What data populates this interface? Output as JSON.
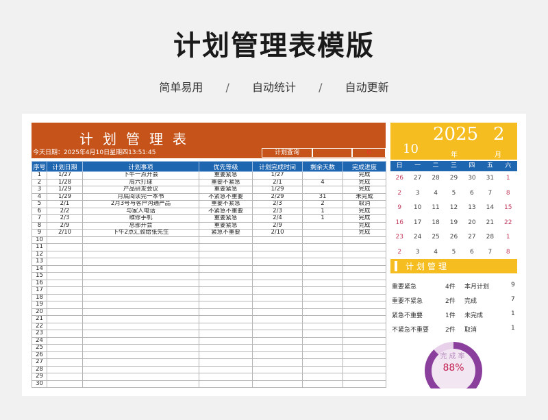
{
  "hero": {
    "title": "计划管理表模版",
    "sub1": "简单易用",
    "sep": "/",
    "sub2": "自动统计",
    "sub3": "自动更新"
  },
  "sheet": {
    "banner_title": "计划管理表",
    "today": "今天日期：2025年4月10日星期四13:51:45",
    "query_label": "计划查询",
    "query_value": "",
    "query_result": "0",
    "columns": [
      "序号",
      "计划日期",
      "计划事项",
      "优先等级",
      "计划完成时间",
      "剩余天数",
      "完成进度"
    ],
    "rows": [
      [
        "1",
        "1/27",
        "下午一点开会",
        "重要紧急",
        "1/27",
        "",
        "完成"
      ],
      [
        "2",
        "1/28",
        "周六打球",
        "重要不紧急",
        "2/1",
        "4",
        "完成"
      ],
      [
        "3",
        "1/29",
        "产品研发会议",
        "重要紧急",
        "1/29",
        "",
        "完成"
      ],
      [
        "4",
        "1/29",
        "月底阅读完一本书",
        "不紧急不重要",
        "2/29",
        "31",
        "未完成"
      ],
      [
        "5",
        "2/1",
        "2月3号与客户沟通产品",
        "重要不紧急",
        "2/3",
        "2",
        "取消"
      ],
      [
        "6",
        "2/2",
        "与家人电话",
        "不紧急不重要",
        "2/3",
        "1",
        "完成"
      ],
      [
        "7",
        "2/3",
        "维修手机",
        "重要紧急",
        "2/4",
        "1",
        "完成"
      ],
      [
        "8",
        "2/9",
        "总部开会",
        "重要紧急",
        "2/9",
        "",
        "完成"
      ],
      [
        "9",
        "2/10",
        "下午2点汇款给张先生",
        "紧急不重要",
        "2/10",
        "",
        "完成"
      ],
      [
        "10",
        "",
        "",
        "",
        "",
        "",
        ""
      ],
      [
        "11",
        "",
        "",
        "",
        "",
        "",
        ""
      ],
      [
        "12",
        "",
        "",
        "",
        "",
        "",
        ""
      ],
      [
        "13",
        "",
        "",
        "",
        "",
        "",
        ""
      ],
      [
        "14",
        "",
        "",
        "",
        "",
        "",
        ""
      ],
      [
        "15",
        "",
        "",
        "",
        "",
        "",
        ""
      ],
      [
        "16",
        "",
        "",
        "",
        "",
        "",
        ""
      ],
      [
        "17",
        "",
        "",
        "",
        "",
        "",
        ""
      ],
      [
        "18",
        "",
        "",
        "",
        "",
        "",
        ""
      ],
      [
        "19",
        "",
        "",
        "",
        "",
        "",
        ""
      ],
      [
        "20",
        "",
        "",
        "",
        "",
        "",
        ""
      ],
      [
        "21",
        "",
        "",
        "",
        "",
        "",
        ""
      ],
      [
        "22",
        "",
        "",
        "",
        "",
        "",
        ""
      ],
      [
        "23",
        "",
        "",
        "",
        "",
        "",
        ""
      ],
      [
        "24",
        "",
        "",
        "",
        "",
        "",
        ""
      ],
      [
        "25",
        "",
        "",
        "",
        "",
        "",
        ""
      ],
      [
        "26",
        "",
        "",
        "",
        "",
        "",
        ""
      ],
      [
        "27",
        "",
        "",
        "",
        "",
        "",
        ""
      ],
      [
        "28",
        "",
        "",
        "",
        "",
        "",
        ""
      ],
      [
        "29",
        "",
        "",
        "",
        "",
        "",
        ""
      ],
      [
        "30",
        "",
        "",
        "",
        "",
        "",
        ""
      ]
    ]
  },
  "calendar": {
    "year": "2025",
    "month": "2",
    "day": "10",
    "year_unit": "年",
    "month_unit": "月",
    "weekdays": [
      "日",
      "一",
      "二",
      "三",
      "四",
      "五",
      "六"
    ],
    "days": [
      [
        "26",
        "27",
        "28",
        "29",
        "30",
        "31",
        "1"
      ],
      [
        "2",
        "3",
        "4",
        "5",
        "6",
        "7",
        "8"
      ],
      [
        "9",
        "10",
        "11",
        "12",
        "13",
        "14",
        "15"
      ],
      [
        "16",
        "17",
        "18",
        "19",
        "20",
        "21",
        "22"
      ],
      [
        "23",
        "24",
        "25",
        "26",
        "27",
        "28",
        "1"
      ],
      [
        "2",
        "3",
        "4",
        "5",
        "6",
        "7",
        "8"
      ]
    ],
    "weekend_color": "#c23a5c"
  },
  "plan_mgmt": {
    "title": "计划管理",
    "left": [
      {
        "label": "重要紧急",
        "value": "4件"
      },
      {
        "label": "重要不紧急",
        "value": "2件"
      },
      {
        "label": "紧急不重要",
        "value": "1件"
      },
      {
        "label": "不紧急不重要",
        "value": "2件"
      }
    ],
    "right": [
      {
        "label": "本月计划",
        "value": "9"
      },
      {
        "label": "完成",
        "value": "7"
      },
      {
        "label": "未完成",
        "value": "1"
      },
      {
        "label": "取消",
        "value": "1"
      }
    ],
    "completion_label": "完成率",
    "completion_pct": "88%",
    "completion_value": 0.88
  },
  "colors": {
    "banner": "#c6531a",
    "header_blue": "#1f66b1",
    "calendar_yellow": "#f5bd1f",
    "ring_purple": "#8a3f9c"
  }
}
